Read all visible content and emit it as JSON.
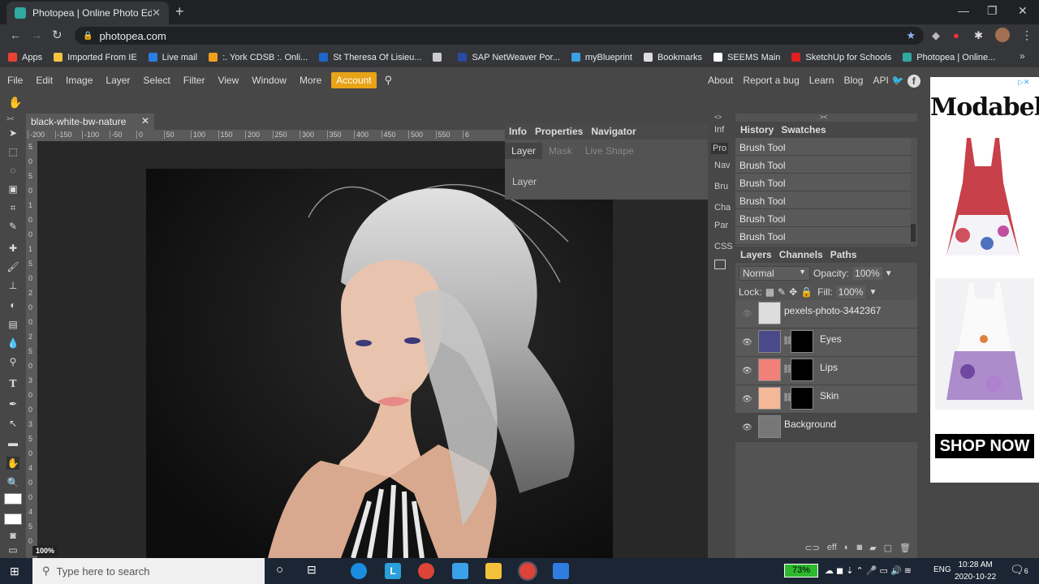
{
  "browser": {
    "tab_title": "Photopea | Online Photo Editor",
    "url": "photopea.com",
    "bookmarks": [
      {
        "label": "Apps",
        "color": "#e94235"
      },
      {
        "label": "Imported From IE",
        "color": "#f5c242"
      },
      {
        "label": "Live mail",
        "color": "#2a7de1"
      },
      {
        "label": ":. York CDSB :. Onli...",
        "color": "#f0a020"
      },
      {
        "label": "St Theresa Of Lisieu...",
        "color": "#1e66c8"
      },
      {
        "label": "",
        "color": "#cccccc"
      },
      {
        "label": "SAP NetWeaver Por...",
        "color": "#2a4aa0"
      },
      {
        "label": "myBlueprint",
        "color": "#3aa0e0"
      },
      {
        "label": "Bookmarks",
        "color": "#dddddd"
      },
      {
        "label": "SEEMS Main",
        "color": "#ffffff"
      },
      {
        "label": "SketchUp for Schools",
        "color": "#e02020"
      },
      {
        "label": "Photopea | Online...",
        "color": "#31a8a0"
      }
    ]
  },
  "menu": {
    "items": [
      "File",
      "Edit",
      "Image",
      "Layer",
      "Select",
      "Filter",
      "View",
      "Window",
      "More"
    ],
    "account": "Account",
    "right": [
      "About",
      "Report a bug",
      "Learn",
      "Blog",
      "API"
    ]
  },
  "document": {
    "tab_name": "black-white-bw-nature",
    "zoom": "100%",
    "ruler_top": [
      "-200",
      "-150",
      "-100",
      "-50",
      "0",
      "50",
      "100",
      "150",
      "200",
      "250",
      "300",
      "350",
      "400",
      "450",
      "500",
      "550",
      "6"
    ],
    "ruler_left": [
      "5",
      "0",
      "5",
      "0",
      "1",
      "0",
      "0",
      "1",
      "5",
      "0",
      "2",
      "0",
      "0",
      "2",
      "5",
      "0",
      "3",
      "0",
      "0",
      "3",
      "5",
      "0",
      "4",
      "0",
      "0",
      "4",
      "5",
      "0"
    ]
  },
  "properties_panel": {
    "tabs": [
      "Info",
      "Properties",
      "Navigator"
    ],
    "subtabs": [
      "Layer",
      "Mask",
      "Live Shape"
    ],
    "content": "Layer"
  },
  "mini_panel": [
    "Inf",
    "Pro",
    "Nav",
    "Bru",
    "Cha",
    "Par",
    "CSS"
  ],
  "history_panel": {
    "tabs": [
      "History",
      "Swatches"
    ],
    "items": [
      "Brush Tool",
      "Brush Tool",
      "Brush Tool",
      "Brush Tool",
      "Brush Tool",
      "Brush Tool"
    ]
  },
  "layers_panel": {
    "tabs": [
      "Layers",
      "Channels",
      "Paths"
    ],
    "blend_mode": "Normal",
    "opacity_label": "Opacity:",
    "opacity": "100%",
    "lock_label": "Lock:",
    "fill_label": "Fill:",
    "fill": "100%",
    "layers": [
      {
        "name": "pexels-photo-3442367",
        "thumb": "#dddddd",
        "visible": false
      },
      {
        "name": "Eyes",
        "thumb": "#4a4a8a",
        "visible": true
      },
      {
        "name": "Lips",
        "thumb": "#f08078",
        "visible": true
      },
      {
        "name": "Skin",
        "thumb": "#f4b898",
        "visible": true
      },
      {
        "name": "Background",
        "thumb": "#777777",
        "visible": true
      }
    ],
    "bottom_icons": [
      "link-icon",
      "eff",
      "adjustment-icon",
      "mask-icon",
      "folder-icon",
      "new-layer-icon",
      "trash-icon"
    ],
    "eff_label": "eff"
  },
  "ad": {
    "brand": "Modabells",
    "cta": "SHOP NOW"
  },
  "taskbar": {
    "search_placeholder": "Type here to search",
    "battery": "73%",
    "language": "ENG",
    "time": "10:28 AM",
    "date": "2020-10-22",
    "notification_count": "6"
  }
}
